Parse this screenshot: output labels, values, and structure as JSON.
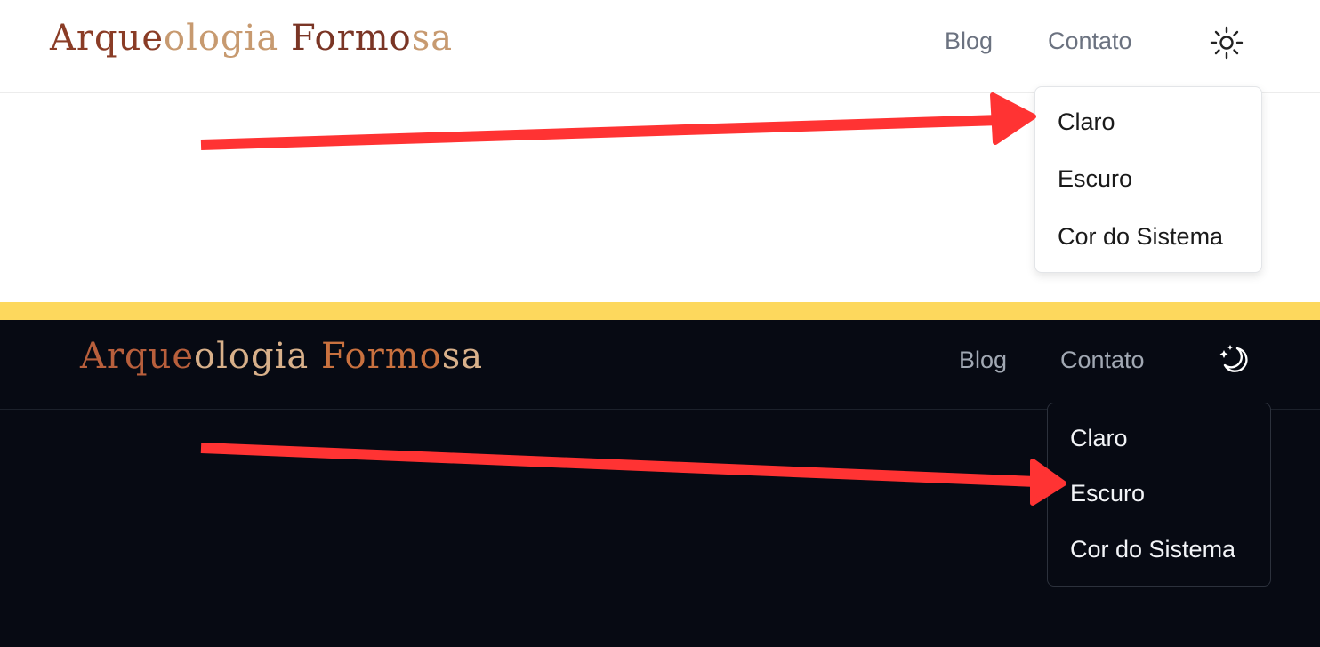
{
  "colors": {
    "annotation_arrow": "#ff3333",
    "divider": "#fdd85d",
    "dark_bg": "#070a13",
    "logo_dark_brown": "#7a3525",
    "logo_tan": "#c79a70"
  },
  "light": {
    "logo_parts": [
      "Arque",
      "ologia",
      " Formo",
      "sa"
    ],
    "nav": {
      "blog": "Blog",
      "contact": "Contato"
    },
    "theme_icon": "sun-icon",
    "menu": {
      "items": [
        "Claro",
        "Escuro",
        "Cor do Sistema"
      ]
    }
  },
  "dark": {
    "logo_parts": [
      "Arque",
      "ologia",
      " Formo",
      "sa"
    ],
    "nav": {
      "blog": "Blog",
      "contact": "Contato"
    },
    "theme_icon": "moon-stars-icon",
    "menu": {
      "items": [
        "Claro",
        "Escuro",
        "Cor do Sistema"
      ]
    }
  }
}
